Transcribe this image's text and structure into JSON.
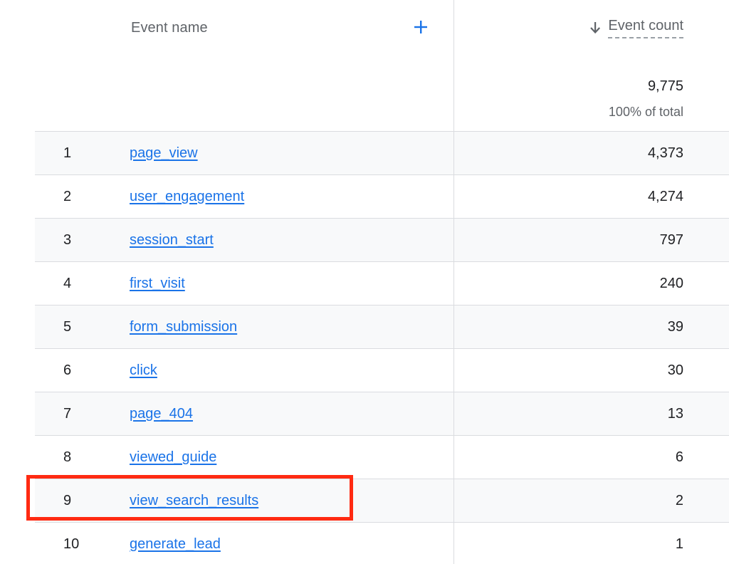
{
  "header": {
    "dimension_label": "Event name",
    "add_icon": "plus-icon",
    "sort_icon": "arrow-down-icon",
    "metric_label": "Event count",
    "total_value": "9,775",
    "total_pct": "100% of total"
  },
  "colors": {
    "link": "#1a73e8",
    "highlight": "#ff2a12",
    "divider": "#dadce0"
  },
  "rows": [
    {
      "index": "1",
      "name": "page_view",
      "count": "4,373"
    },
    {
      "index": "2",
      "name": "user_engagement",
      "count": "4,274"
    },
    {
      "index": "3",
      "name": "session_start",
      "count": "797"
    },
    {
      "index": "4",
      "name": "first_visit",
      "count": "240"
    },
    {
      "index": "5",
      "name": "form_submission",
      "count": "39"
    },
    {
      "index": "6",
      "name": "click",
      "count": "30"
    },
    {
      "index": "7",
      "name": "page_404",
      "count": "13"
    },
    {
      "index": "8",
      "name": "viewed_guide",
      "count": "6"
    },
    {
      "index": "9",
      "name": "view_search_results",
      "count": "2"
    },
    {
      "index": "10",
      "name": "generate_lead",
      "count": "1"
    }
  ]
}
